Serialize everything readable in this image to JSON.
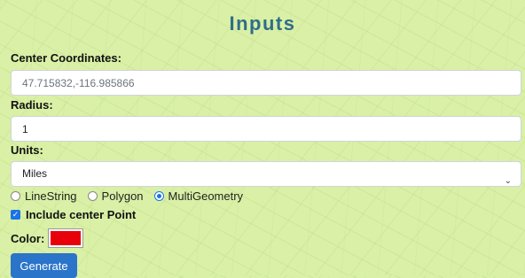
{
  "title": "Inputs",
  "center": {
    "label": "Center Coordinates:",
    "placeholder": "47.715832,-116.985866",
    "value": ""
  },
  "radius": {
    "label": "Radius:",
    "value": "1"
  },
  "units": {
    "label": "Units:",
    "selected": "Miles"
  },
  "geometry": {
    "options": [
      "LineString",
      "Polygon",
      "MultiGeometry"
    ],
    "selected": "MultiGeometry"
  },
  "include_center": {
    "label": "Include center Point",
    "checked": true
  },
  "color": {
    "label": "Color:",
    "value": "#e8000b"
  },
  "generate_label": "Generate",
  "colors": {
    "background": "#d9f0a6",
    "title": "#2f6e8a",
    "accent": "#1a73e8",
    "button": "#2a74c9"
  }
}
